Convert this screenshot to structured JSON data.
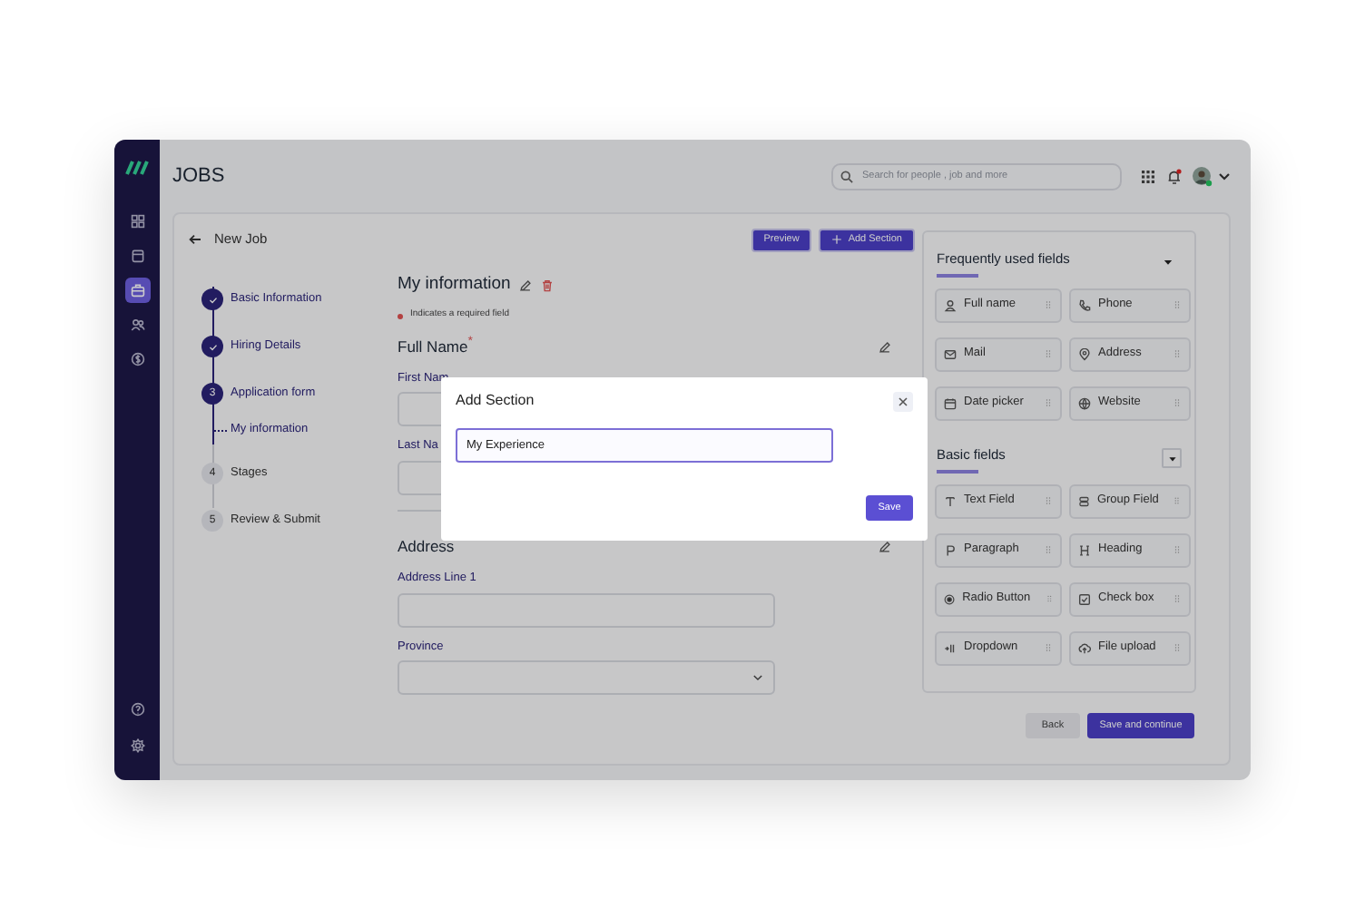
{
  "header": {
    "title": "JOBS",
    "search": {
      "placeholder": "Search for people , job and more"
    }
  },
  "sidebar": {
    "items": [
      {
        "selected": false
      },
      {
        "selected": false
      },
      {
        "selected": true
      },
      {
        "selected": false
      },
      {
        "selected": false
      }
    ],
    "bottom_items": [
      {
        "selected": false
      },
      {
        "selected": false
      }
    ]
  },
  "page": {
    "back_label": "New Job",
    "buttons": [
      "Preview",
      "Add Section"
    ]
  },
  "steps": [
    {
      "label": "Basic Information",
      "completed": true,
      "selected": false
    },
    {
      "label": "Hiring Details",
      "completed": true,
      "selected": false
    },
    {
      "label": "Application form",
      "number": "3",
      "completed": false,
      "selected": true,
      "children": [
        {
          "label": "My information",
          "selected": true
        }
      ]
    },
    {
      "label": "Stages",
      "number": "4",
      "completed": false,
      "selected": false
    },
    {
      "label": "Review & Submit",
      "number": "5",
      "completed": false,
      "selected": false
    }
  ],
  "form": {
    "title": "My information",
    "required_note": "Indicates a required field",
    "sections": [
      {
        "title": "Full Name$^{*}$",
        "fields": [
          {
            "label": "First Nam",
            "kind": "text"
          },
          {
            "label": "Last Na",
            "kind": "text"
          }
        ]
      },
      {
        "title": "Address",
        "fields": [
          {
            "label": "Address Line 1",
            "kind": "text"
          },
          {
            "label": "Province",
            "kind": "select"
          }
        ]
      }
    ]
  },
  "field_panel": {
    "groups": [
      {
        "title": "Frequently used fields",
        "items": [
          {
            "label": "Full name"
          },
          {
            "label": "Phone"
          },
          {
            "label": "Mail"
          },
          {
            "label": "Address"
          },
          {
            "label": "Date picker"
          },
          {
            "label": "Website"
          }
        ]
      },
      {
        "title": "Basic fields",
        "items": [
          {
            "label": "Text Field"
          },
          {
            "label": "Group Field"
          },
          {
            "label": "Paragraph"
          },
          {
            "label": "Heading"
          },
          {
            "label": "Radio Button"
          },
          {
            "label": "Check box"
          },
          {
            "label": "Dropdown"
          },
          {
            "label": "File upload"
          }
        ]
      }
    ]
  },
  "footer": {
    "buttons": [
      "Back",
      "Save and continue"
    ]
  },
  "modal": {
    "title": "Add Section",
    "input": {
      "value": "My Experience"
    },
    "button": "Save"
  }
}
